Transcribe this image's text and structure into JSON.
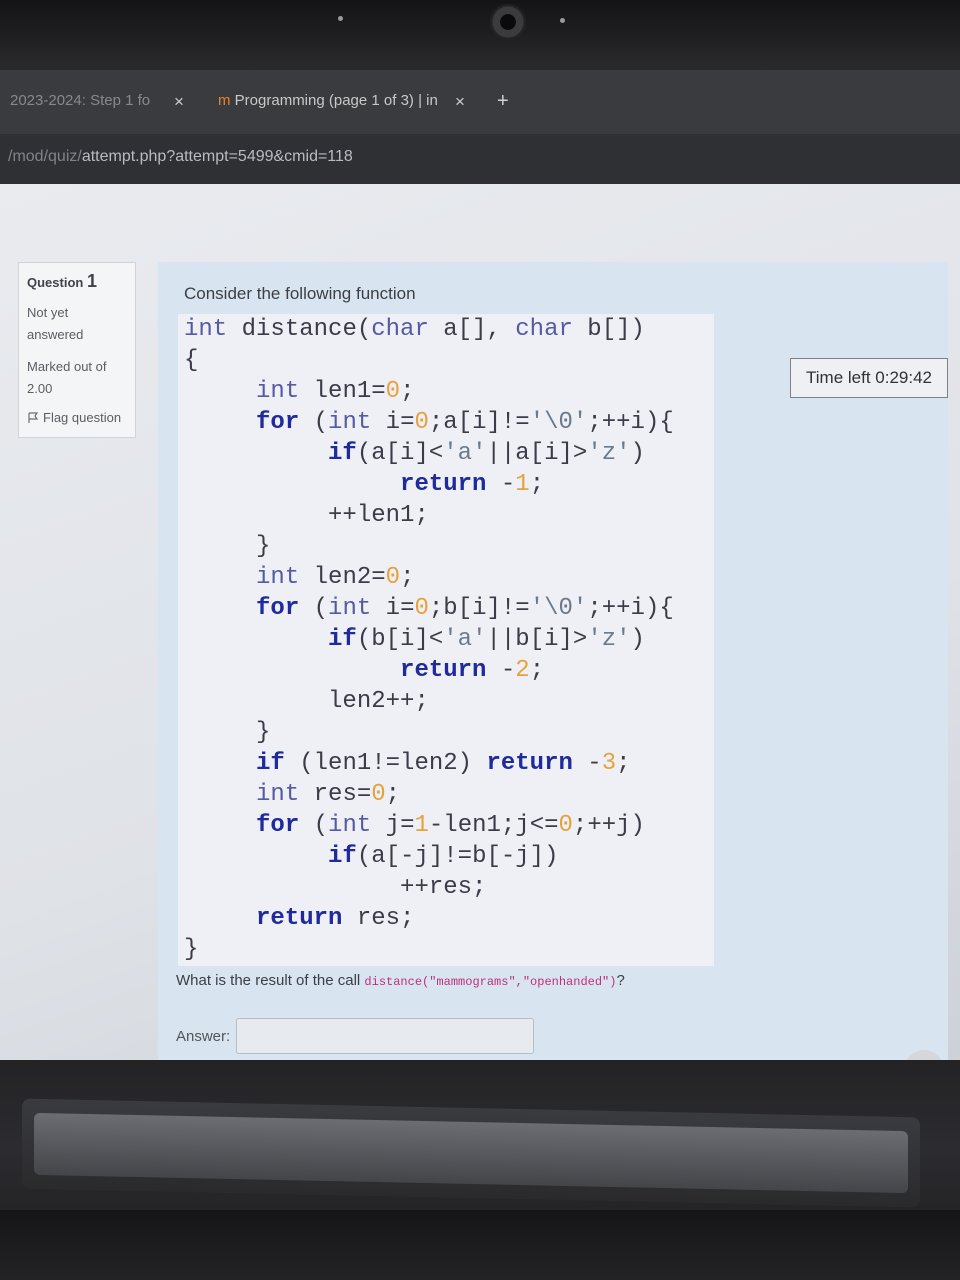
{
  "browser": {
    "tabs": [
      {
        "label": "2023-2024: Step 1 fo",
        "close": "×"
      },
      {
        "label": "Programming (page 1 of 3) | in",
        "close": "×"
      }
    ],
    "new_tab": "+",
    "url_prefix": "/mod/quiz/",
    "url": "attempt.php?attempt=5499&cmid=118"
  },
  "question_info": {
    "label": "Question",
    "number": "1",
    "status": "Not yet answered",
    "marks": "Marked out of 2.00",
    "flag": "Flag question"
  },
  "question": {
    "prompt": "Consider the following function",
    "call_text": "What is the result of the call",
    "call_code": "distance(\"mammograms\",\"openhanded\")",
    "call_end": "?",
    "answer_label": "Answer:",
    "answer_value": ""
  },
  "timer": {
    "text": "Time left 0:29:42"
  },
  "help": {
    "label": "?"
  }
}
